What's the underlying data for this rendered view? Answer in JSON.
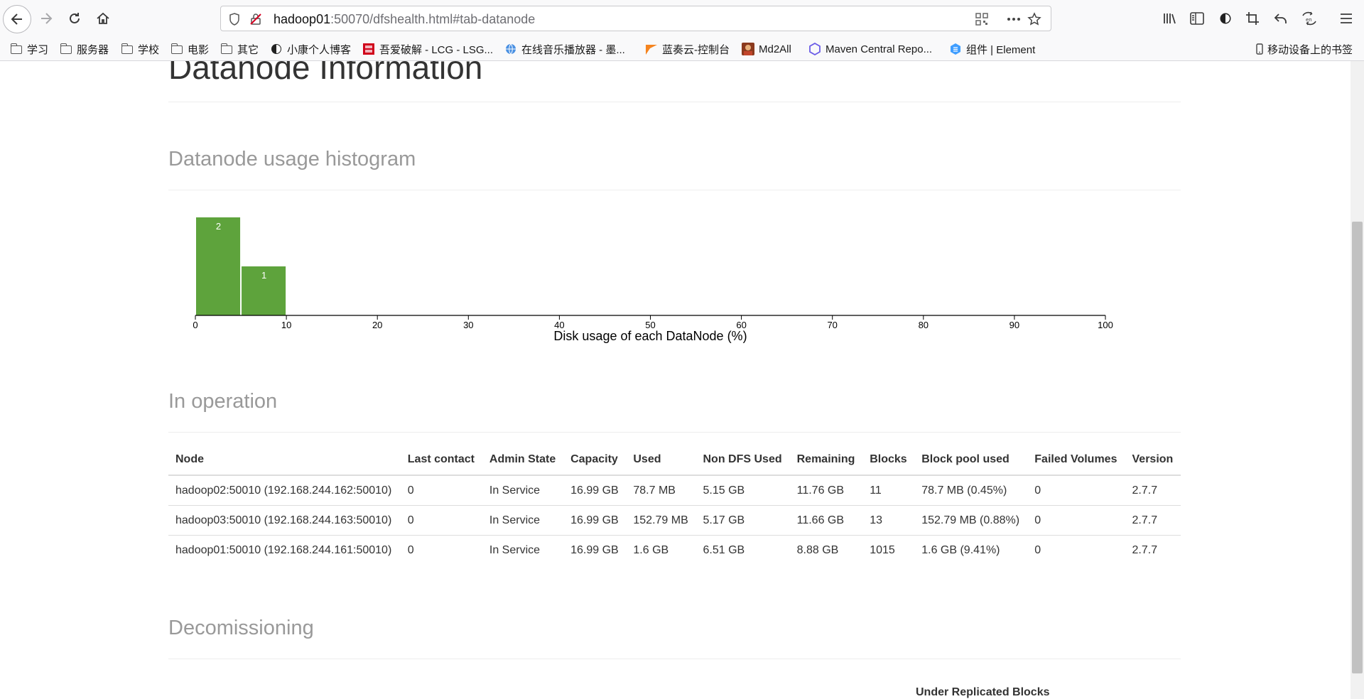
{
  "browser": {
    "url_host": "hadoop01",
    "url_rest": ":50070/dfshealth.html#tab-datanode",
    "bookmarks": [
      {
        "label": "学习",
        "icon": "folder-icon"
      },
      {
        "label": "服务器",
        "icon": "folder-icon"
      },
      {
        "label": "学校",
        "icon": "folder-icon"
      },
      {
        "label": "电影",
        "icon": "folder-icon"
      },
      {
        "label": "其它",
        "icon": "folder-icon"
      },
      {
        "label": "小康个人博客",
        "icon": "site-icon"
      },
      {
        "label": "吾爱破解 - LCG - LSG...",
        "icon": "site-icon"
      },
      {
        "label": "在线音乐播放器 - 墨...",
        "icon": "globe-icon"
      },
      {
        "label": "蓝奏云-控制台",
        "icon": "site-icon"
      },
      {
        "label": "Md2All",
        "icon": "site-icon"
      },
      {
        "label": "Maven Central Repo...",
        "icon": "hexagon-icon"
      },
      {
        "label": "组件 | Element",
        "icon": "element-icon"
      }
    ],
    "mobile_bookmarks": "移动设备上的书签",
    "colors": {
      "chrome_bg": "#f9f9fa",
      "accent_bar": "#5ea33c"
    }
  },
  "page": {
    "title": "Datanode Information",
    "histogram_heading": "Datanode usage histogram",
    "in_operation_heading": "In operation",
    "decommissioning_heading": "Decomissioning",
    "under_replicated_blocks_label": "Under Replicated Blocks"
  },
  "chart_data": {
    "type": "bar",
    "title": "",
    "xlabel": "Disk usage of each DataNode (%)",
    "ylabel": "",
    "xlim": [
      0,
      100
    ],
    "x_ticks": [
      "0",
      "10",
      "20",
      "30",
      "40",
      "50",
      "60",
      "70",
      "80",
      "90",
      "100"
    ],
    "bins": [
      {
        "from": 0,
        "to": 5,
        "count": 2,
        "label": "2"
      },
      {
        "from": 5,
        "to": 10,
        "count": 1,
        "label": "1"
      }
    ],
    "grid": false,
    "bar_color": "#5ea33c"
  },
  "table": {
    "headers": [
      "Node",
      "Last contact",
      "Admin State",
      "Capacity",
      "Used",
      "Non DFS Used",
      "Remaining",
      "Blocks",
      "Block pool used",
      "Failed Volumes",
      "Version"
    ],
    "rows": [
      [
        "hadoop02:50010 (192.168.244.162:50010)",
        "0",
        "In Service",
        "16.99 GB",
        "78.7 MB",
        "5.15 GB",
        "11.76 GB",
        "11",
        "78.7 MB (0.45%)",
        "0",
        "2.7.7"
      ],
      [
        "hadoop03:50010 (192.168.244.163:50010)",
        "0",
        "In Service",
        "16.99 GB",
        "152.79 MB",
        "5.17 GB",
        "11.66 GB",
        "13",
        "152.79 MB (0.88%)",
        "0",
        "2.7.7"
      ],
      [
        "hadoop01:50010 (192.168.244.161:50010)",
        "0",
        "In Service",
        "16.99 GB",
        "1.6 GB",
        "6.51 GB",
        "8.88 GB",
        "1015",
        "1.6 GB (9.41%)",
        "0",
        "2.7.7"
      ]
    ]
  }
}
